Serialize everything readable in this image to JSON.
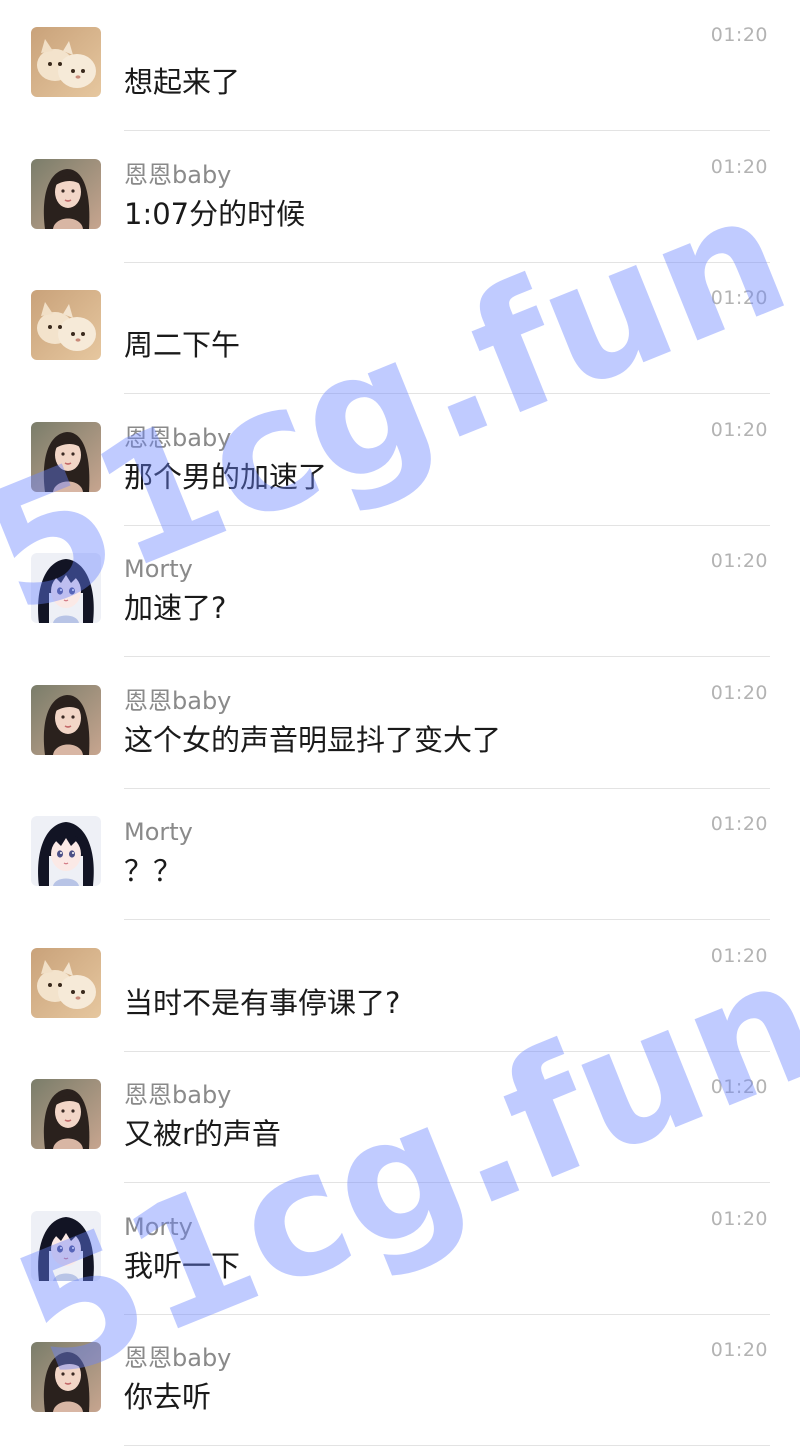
{
  "messages": [
    {
      "avatar": "cat",
      "avatar_icon": "cat-photo-avatar",
      "sender": "",
      "text": "想起来了",
      "time": "01:20"
    },
    {
      "avatar": "girl",
      "avatar_icon": "girl-photo-avatar",
      "sender": "恩恩baby",
      "text": "1:07分的时候",
      "time": "01:20"
    },
    {
      "avatar": "cat",
      "avatar_icon": "cat-photo-avatar",
      "sender": "",
      "text": "周二下午",
      "time": "01:20"
    },
    {
      "avatar": "girl",
      "avatar_icon": "girl-photo-avatar",
      "sender": "恩恩baby",
      "text": "那个男的加速了",
      "time": "01:20"
    },
    {
      "avatar": "anime",
      "avatar_icon": "anime-girl-avatar",
      "sender": "Morty",
      "text": "加速了?",
      "time": "01:20"
    },
    {
      "avatar": "girl",
      "avatar_icon": "girl-photo-avatar",
      "sender": "恩恩baby",
      "text": "这个女的声音明显抖了变大了",
      "time": "01:20"
    },
    {
      "avatar": "anime",
      "avatar_icon": "anime-girl-avatar",
      "sender": "Morty",
      "text": "？？",
      "time": "01:20"
    },
    {
      "avatar": "cat",
      "avatar_icon": "cat-photo-avatar",
      "sender": "",
      "text": "当时不是有事停课了?",
      "time": "01:20"
    },
    {
      "avatar": "girl",
      "avatar_icon": "girl-photo-avatar",
      "sender": "恩恩baby",
      "text": "又被r的声音",
      "time": "01:20"
    },
    {
      "avatar": "anime",
      "avatar_icon": "anime-girl-avatar",
      "sender": "Morty",
      "text": "我听一下",
      "time": "01:20"
    },
    {
      "avatar": "girl",
      "avatar_icon": "girl-photo-avatar",
      "sender": "恩恩baby",
      "text": "你去听",
      "time": "01:20"
    }
  ],
  "watermark": {
    "text": "51cg.fun",
    "color": "#6982ff"
  },
  "colors": {
    "sender": "#8a8a8a",
    "time": "#b3b3b3",
    "text": "#1a1a1a",
    "divider": "#e3e3e3"
  }
}
